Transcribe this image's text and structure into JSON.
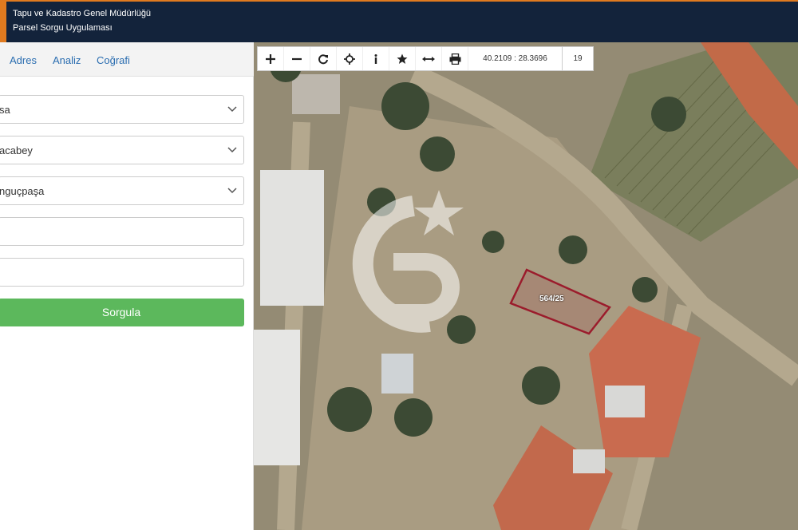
{
  "header": {
    "title_line1": "Tapu ve Kadastro Genel Müdürlüğü",
    "title_line2": "Parsel Sorgu Uygulaması"
  },
  "tabs": [
    {
      "label": "Adres"
    },
    {
      "label": "Analiz"
    },
    {
      "label": "Coğrafi"
    }
  ],
  "form": {
    "province": "sa",
    "district": "acabey",
    "neighborhood": "nguçpaşa",
    "block": "",
    "parcel": "",
    "submit_label": "Sorgula"
  },
  "toolbar": {
    "icons": [
      "zoom-in-icon",
      "zoom-out-icon",
      "refresh-icon",
      "locate-icon",
      "info-icon",
      "star-icon",
      "measure-icon",
      "print-icon"
    ],
    "coordinates": "40.2109 : 28.3696",
    "zoom_level": "19"
  },
  "map": {
    "parcel_label": "564/25",
    "watermark": "CB",
    "parcel_color": "#9b1c2c",
    "accent": "#e07a1f",
    "button_color": "#5cb85c"
  }
}
